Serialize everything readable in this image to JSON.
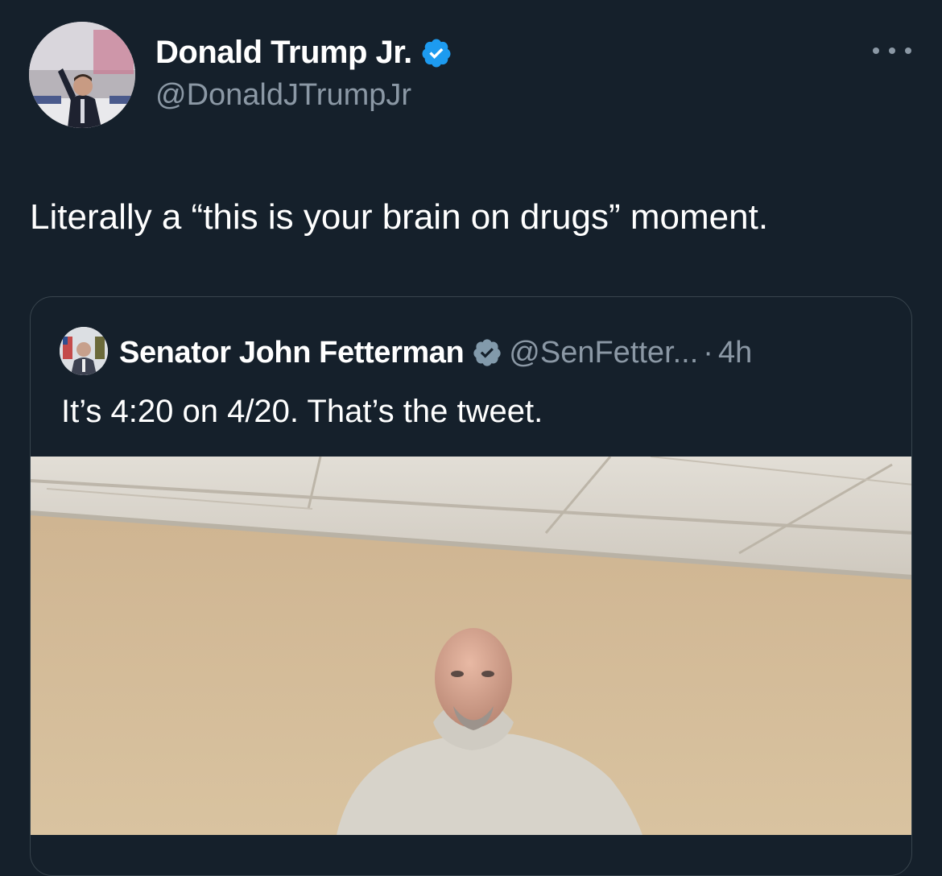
{
  "tweet": {
    "author": {
      "display_name": "Donald Trump Jr.",
      "handle": "@DonaldJTrumpJr",
      "verified_icon": "verified-badge-icon",
      "avatar": "profile-photo"
    },
    "more_icon": "more-options-icon",
    "text": "Literally a “this is your brain on drugs” moment."
  },
  "quoted_tweet": {
    "author": {
      "display_name": "Senator John Fetterman",
      "handle": "@SenFetter...",
      "verified_icon": "verified-badge-icon"
    },
    "separator": "·",
    "time": "4h",
    "text": "It’s 4:20 on 4/20. That’s the tweet.",
    "media": "photo-of-man-in-gray-hoodie"
  },
  "colors": {
    "background": "#15202b",
    "secondary_text": "#8b98a5",
    "verified_blue": "#1d9bf0",
    "verified_gray": "#829aab",
    "border": "#38444d"
  }
}
